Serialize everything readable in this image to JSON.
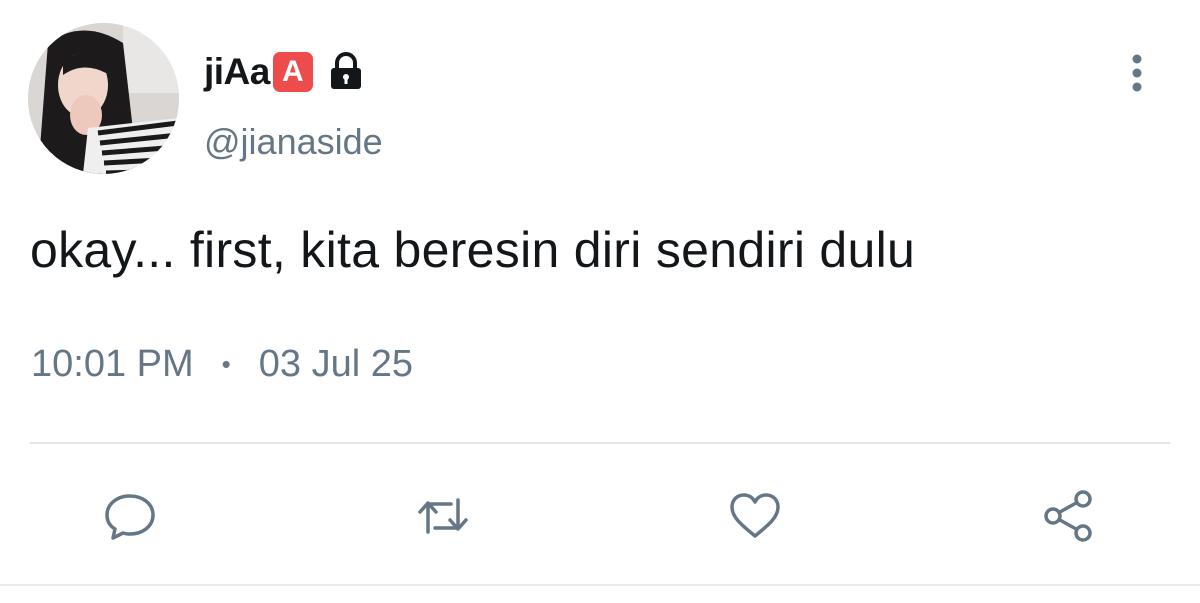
{
  "tweet": {
    "display_name": "jiAa",
    "badge_letter": "A",
    "handle": "@jianaside",
    "text": "okay... first, kita beresin diri sendiri dulu",
    "time": "10:01 PM",
    "separator": "•",
    "date": "03 Jul 25"
  },
  "icons": {
    "badge": "red-a-emoji",
    "protected": "lock-icon",
    "more": "more-vertical-icon",
    "actions": [
      "reply-icon",
      "retweet-icon",
      "like-icon",
      "share-icon"
    ]
  },
  "colors": {
    "text": "#14171a",
    "secondary": "#657786",
    "divider": "#e1e8ed",
    "badge": "#ee4b4b"
  }
}
